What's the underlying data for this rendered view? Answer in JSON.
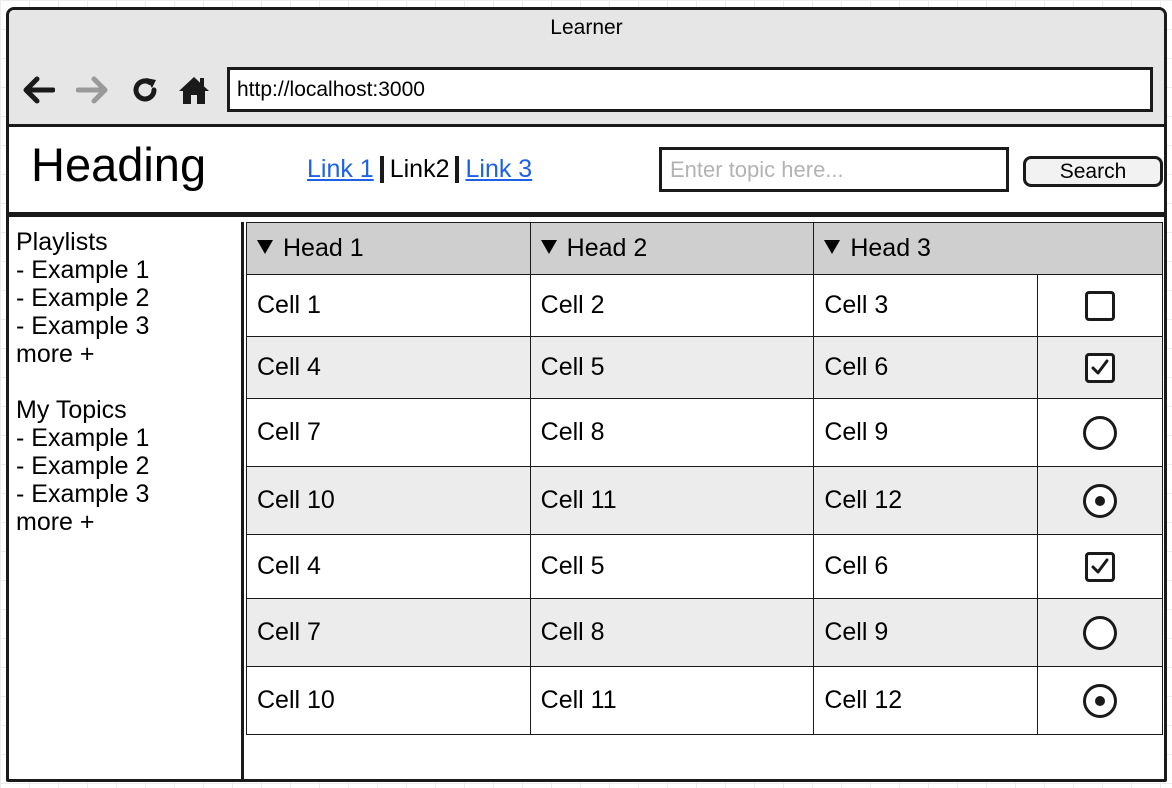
{
  "window": {
    "title": "Learner"
  },
  "browser": {
    "url": "http://localhost:3000",
    "icons": [
      "back-arrow-icon",
      "forward-arrow-icon",
      "reload-icon",
      "home-icon"
    ]
  },
  "header": {
    "heading": "Heading",
    "links": [
      "Link 1",
      "Link2",
      "Link 3"
    ],
    "search": {
      "placeholder": "Enter topic here...",
      "button_label": "Search"
    }
  },
  "sidebar": {
    "playlists": {
      "title": "Playlists",
      "items": [
        "- Example 1",
        "- Example 2",
        "- Example 3"
      ],
      "more": "more +"
    },
    "topics": {
      "title": "My Topics",
      "items": [
        "- Example 1",
        "- Example 2",
        "- Example 3"
      ],
      "more": "more +"
    }
  },
  "table": {
    "headers": [
      "Head 1",
      "Head 2",
      "Head 3"
    ],
    "rows": [
      {
        "cells": [
          "Cell 1",
          "Cell 2",
          "Cell 3"
        ],
        "control": "checkbox",
        "checked": false
      },
      {
        "cells": [
          "Cell 4",
          "Cell 5",
          "Cell 6"
        ],
        "control": "checkbox",
        "checked": true
      },
      {
        "cells": [
          "Cell 7",
          "Cell 8",
          "Cell 9"
        ],
        "control": "radio",
        "checked": false
      },
      {
        "cells": [
          "Cell 10",
          "Cell 11",
          "Cell 12"
        ],
        "control": "radio",
        "checked": true
      },
      {
        "cells": [
          "Cell 4",
          "Cell 5",
          "Cell 6"
        ],
        "control": "checkbox",
        "checked": true
      },
      {
        "cells": [
          "Cell 7",
          "Cell 8",
          "Cell 9"
        ],
        "control": "radio",
        "checked": false
      },
      {
        "cells": [
          "Cell 10",
          "Cell 11",
          "Cell 12"
        ],
        "control": "radio",
        "checked": true
      }
    ]
  },
  "colors": {
    "link": "#1d62e6",
    "chrome": "#e6e6e6",
    "header_row": "#cfcfcf",
    "stripe": "#ececec"
  }
}
